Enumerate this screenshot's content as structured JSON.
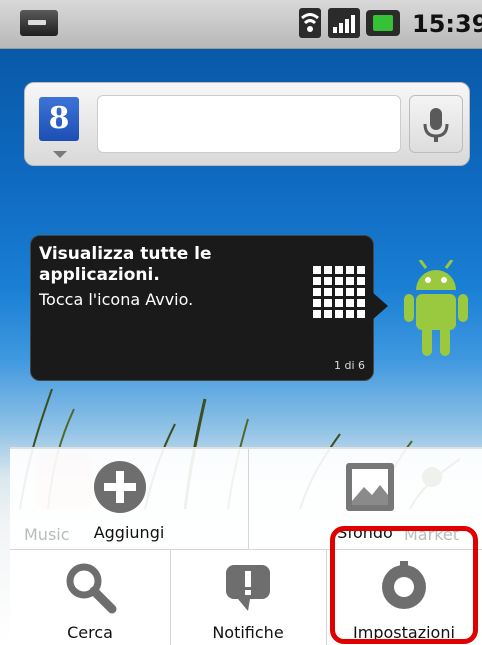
{
  "status_bar": {
    "time": "15:39",
    "icons": [
      "notification-icon",
      "wifi-icon",
      "signal-icon",
      "battery-icon"
    ]
  },
  "search_widget": {
    "google_label": "8",
    "icons": [
      "google-search-icon",
      "microphone-icon"
    ]
  },
  "tooltip": {
    "title": "Visualizza tutte le applicazioni.",
    "body": "Tocca l'icona Avvio.",
    "page": "1 di 6"
  },
  "background_apps": [
    "Music",
    "Market"
  ],
  "menu": {
    "items": [
      {
        "label": "Aggiungi",
        "icon": "add-icon"
      },
      {
        "label": "Sfondo",
        "icon": "wallpaper-icon"
      },
      {
        "label": "Cerca",
        "icon": "search-icon"
      },
      {
        "label": "Notifiche",
        "icon": "notifications-icon"
      },
      {
        "label": "Impostazioni",
        "icon": "settings-icon"
      }
    ]
  },
  "colors": {
    "highlight": "#e00000",
    "status_bar": "#c8c8c8",
    "battery": "#36c236"
  }
}
